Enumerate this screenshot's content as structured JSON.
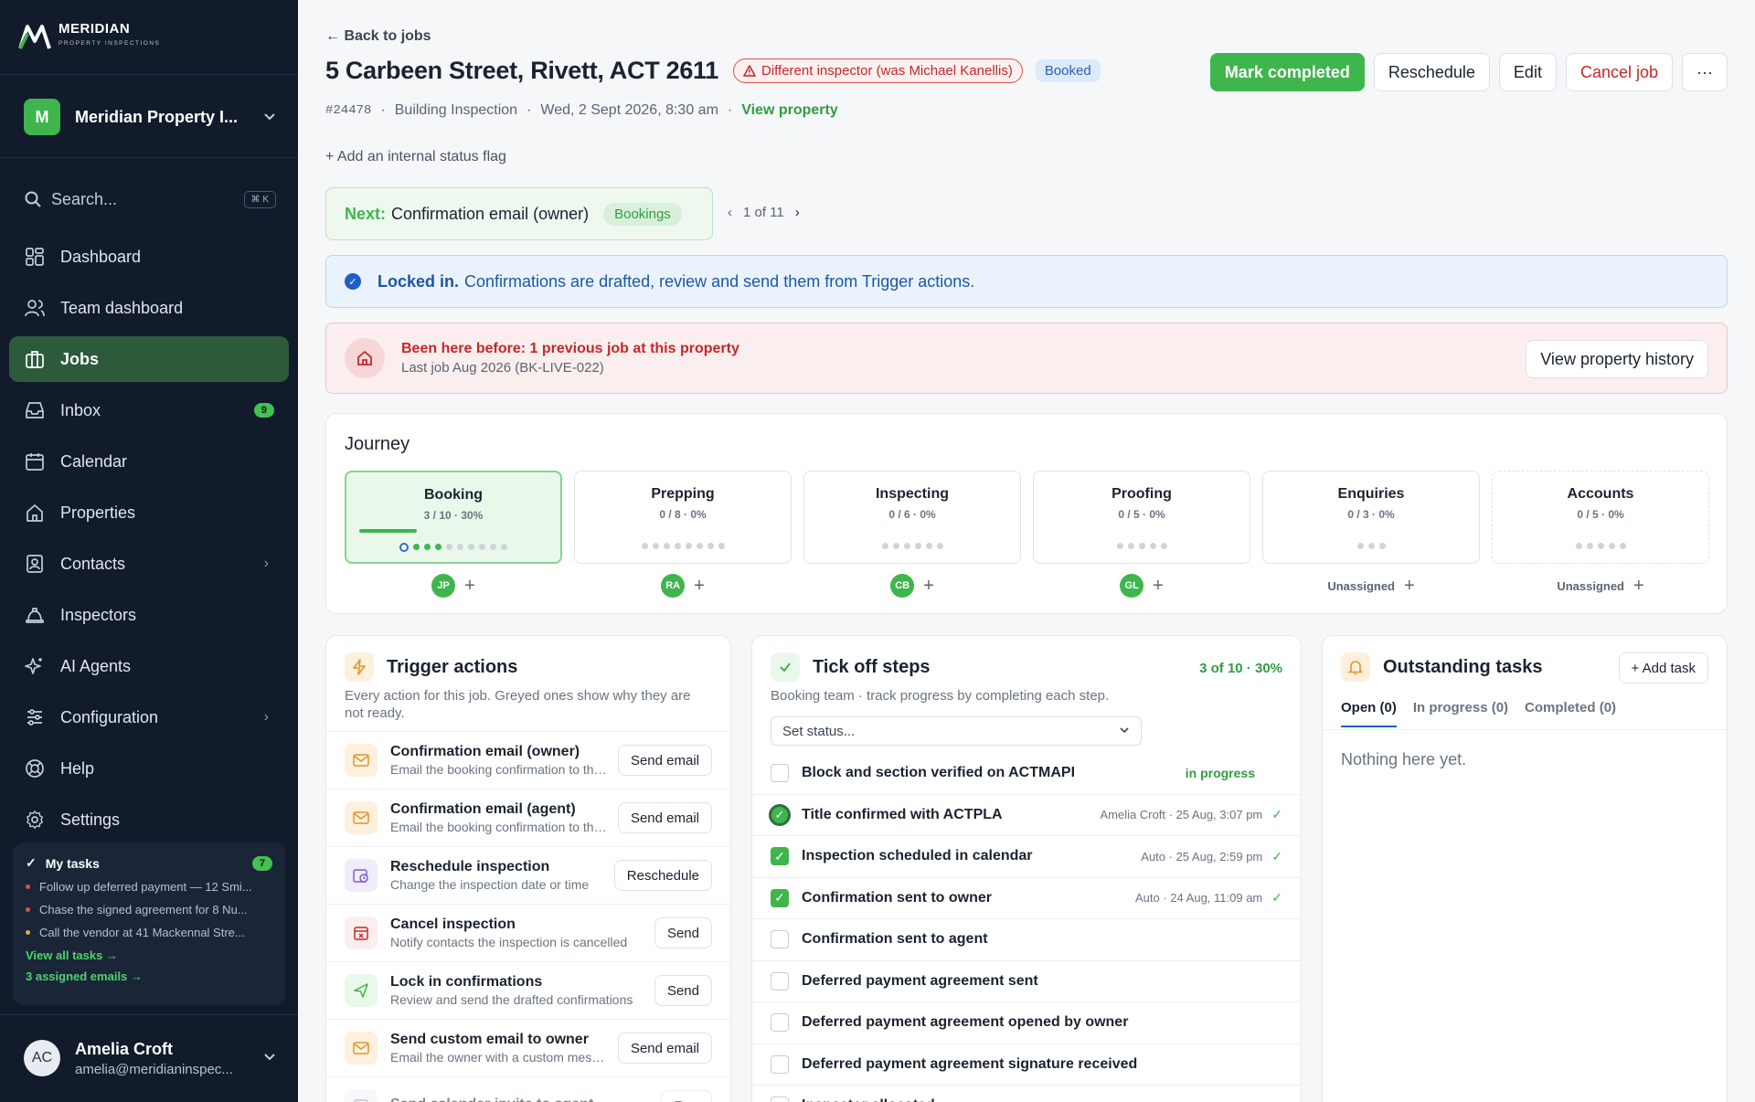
{
  "sidebar": {
    "brand": "MERIDIAN",
    "brand_sub": "PROPERTY INSPECTIONS",
    "org_initial": "M",
    "org_name": "Meridian Property I...",
    "search_placeholder": "Search...",
    "search_shortcut": "⌘ K",
    "nav": [
      {
        "label": "Dashboard",
        "icon": "dashboard-icon"
      },
      {
        "label": "Team dashboard",
        "icon": "team-icon"
      },
      {
        "label": "Jobs",
        "icon": "jobs-icon",
        "active": true
      },
      {
        "label": "Inbox",
        "icon": "inbox-icon",
        "badge": "9"
      },
      {
        "label": "Calendar",
        "icon": "calendar-icon"
      },
      {
        "label": "Properties",
        "icon": "home-icon"
      },
      {
        "label": "Contacts",
        "icon": "contacts-icon",
        "has_submenu": true
      },
      {
        "label": "Inspectors",
        "icon": "hardhat-icon"
      },
      {
        "label": "AI Agents",
        "icon": "sparkle-icon"
      },
      {
        "label": "Configuration",
        "icon": "sliders-icon",
        "has_submenu": true
      },
      {
        "label": "Help",
        "icon": "help-icon"
      },
      {
        "label": "Settings",
        "icon": "gear-icon"
      }
    ],
    "my_tasks": {
      "title": "My tasks",
      "count": "7",
      "items": [
        {
          "text": "Follow up deferred payment — 12 Smi...",
          "color": "#e04e4e"
        },
        {
          "text": "Chase the signed agreement for 8 Nu...",
          "color": "#e04e4e"
        },
        {
          "text": "Call the vendor at 41 Mackennal Stre...",
          "color": "#e0a84e"
        }
      ],
      "view_all": "View all tasks →",
      "assigned": "3 assigned emails →"
    },
    "user": {
      "initials": "AC",
      "name": "Amelia Croft",
      "email": "amelia@meridianinspec..."
    }
  },
  "header": {
    "back": "← Back to jobs",
    "title": "5 Carbeen Street, Rivett, ACT 2611",
    "warning_pill": "Different inspector (was Michael Kanellis)",
    "status_pill": "Booked",
    "actions": {
      "complete": "Mark completed",
      "reschedule": "Reschedule",
      "edit": "Edit",
      "cancel": "Cancel job",
      "more": "···"
    },
    "job_id": "#24478",
    "job_type": "Building Inspection",
    "job_date": "Wed, 2 Sept 2026, 8:30 am",
    "view_property": "View property",
    "add_flag": "+ Add an internal status flag"
  },
  "next": {
    "label": "Next:",
    "text": "Confirmation email (owner)",
    "tag": "Bookings",
    "pager": "1 of 11"
  },
  "banner_info": {
    "bold": "Locked in.",
    "text": "Confirmations are drafted, review and send them from Trigger actions."
  },
  "banner_warn": {
    "title": "Been here before: 1 previous job at this property",
    "sub": "Last job Aug 2026 (BK-LIVE-022)",
    "button": "View property history"
  },
  "journey": {
    "title": "Journey",
    "stages": [
      {
        "name": "Booking",
        "progress": "3 / 10 · 30%",
        "done": 3,
        "total": 10,
        "owner": "JP"
      },
      {
        "name": "Prepping",
        "progress": "0 / 8 · 0%",
        "done": 0,
        "total": 8,
        "owner": "RA"
      },
      {
        "name": "Inspecting",
        "progress": "0 / 6 · 0%",
        "done": 0,
        "total": 6,
        "owner": "CB"
      },
      {
        "name": "Proofing",
        "progress": "0 / 5 · 0%",
        "done": 0,
        "total": 5,
        "owner": "GL"
      },
      {
        "name": "Enquiries",
        "progress": "0 / 3 · 0%",
        "done": 0,
        "total": 3,
        "owner": "Unassigned"
      },
      {
        "name": "Accounts",
        "progress": "0 / 5 · 0%",
        "done": 0,
        "total": 5,
        "owner": "Unassigned"
      }
    ]
  },
  "trigger": {
    "title": "Trigger actions",
    "desc": "Every action for this job. Greyed ones show why they are not ready.",
    "items": [
      {
        "title": "Confirmation email (owner)",
        "sub": "Email the booking confirmation to the owner",
        "button": "Send email",
        "icon": "mail-icon"
      },
      {
        "title": "Confirmation email (agent)",
        "sub": "Email the booking confirmation to the agent",
        "button": "Send email",
        "icon": "mail-icon"
      },
      {
        "title": "Reschedule inspection",
        "sub": "Change the inspection date or time",
        "button": "Reschedule",
        "icon": "calendar-clock-icon"
      },
      {
        "title": "Cancel inspection",
        "sub": "Notify contacts the inspection is cancelled",
        "button": "Send",
        "icon": "calendar-x-icon"
      },
      {
        "title": "Lock in confirmations",
        "sub": "Review and send the drafted confirmations",
        "button": "Send",
        "icon": "send-icon"
      },
      {
        "title": "Send custom email to owner",
        "sub": "Email the owner with a custom message",
        "button": "Send email",
        "icon": "mail-icon"
      },
      {
        "title": "Send calendar invite to agent",
        "sub": "",
        "button": "Run",
        "icon": "calendar-icon",
        "dim": true
      }
    ]
  },
  "tick": {
    "title": "Tick off steps",
    "count": "3 of 10 · 30%",
    "desc": "Booking team · track progress by completing each step.",
    "select": "Set status...",
    "steps": [
      {
        "label": "Block and section verified on ACTMAPI",
        "status": "in progress",
        "meta": "",
        "state": "empty"
      },
      {
        "label": "Title confirmed with ACTPLA",
        "status": "",
        "meta": "Amelia Croft · 25 Aug, 3:07 pm",
        "state": "ring"
      },
      {
        "label": "Inspection scheduled in calendar",
        "status": "",
        "meta": "Auto · 25 Aug, 2:59 pm",
        "state": "on"
      },
      {
        "label": "Confirmation sent to owner",
        "status": "",
        "meta": "Auto · 24 Aug, 11:09 am",
        "state": "on"
      },
      {
        "label": "Confirmation sent to agent",
        "status": "",
        "meta": "",
        "state": "empty"
      },
      {
        "label": "Deferred payment agreement sent",
        "status": "",
        "meta": "",
        "state": "empty"
      },
      {
        "label": "Deferred payment agreement opened by owner",
        "status": "",
        "meta": "",
        "state": "empty"
      },
      {
        "label": "Deferred payment agreement signature received",
        "status": "",
        "meta": "",
        "state": "empty"
      },
      {
        "label": "Inspector allocated",
        "status": "",
        "meta": "",
        "state": "empty"
      }
    ]
  },
  "outstanding": {
    "title": "Outstanding tasks",
    "add": "+ Add task",
    "tabs": [
      "Open (0)",
      "In progress (0)",
      "Completed (0)"
    ],
    "empty": "Nothing here yet."
  },
  "colors": {
    "accent": "#3fb54d",
    "sidebar_bg": "#111b2b",
    "danger": "#c62828",
    "info": "#1d56a3"
  }
}
